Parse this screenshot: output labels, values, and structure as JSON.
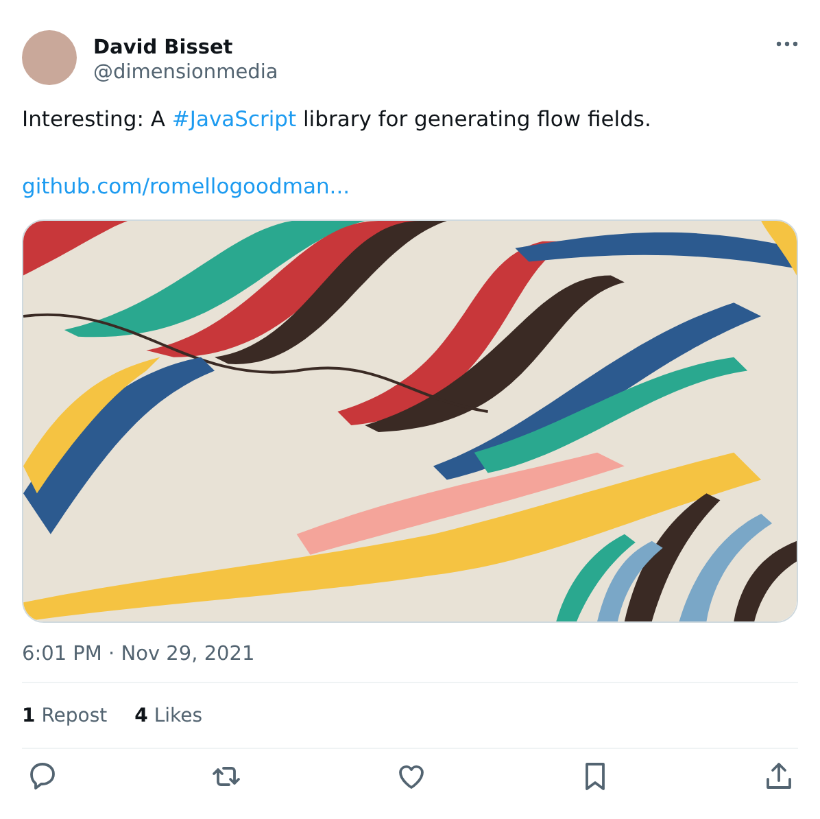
{
  "post": {
    "author": {
      "name": "David Bisset",
      "handle": "@dimensionmedia"
    },
    "text_before": "Interesting: A ",
    "hashtag": "#JavaScript",
    "text_after": " library for generating flow fields.",
    "link": "github.com/romellogoodman...",
    "timestamp": "6:01 PM · Nov 29, 2021",
    "stats": [
      {
        "text": "**1** Repost"
      },
      {
        "text": "**4** Likes"
      }
    ],
    "actions": [
      {
        "kind": "reply"
      },
      {
        "kind": "repost"
      },
      {
        "kind": "like"
      },
      {
        "kind": "bookmark"
      },
      {
        "kind": "share"
      }
    ]
  }
}
